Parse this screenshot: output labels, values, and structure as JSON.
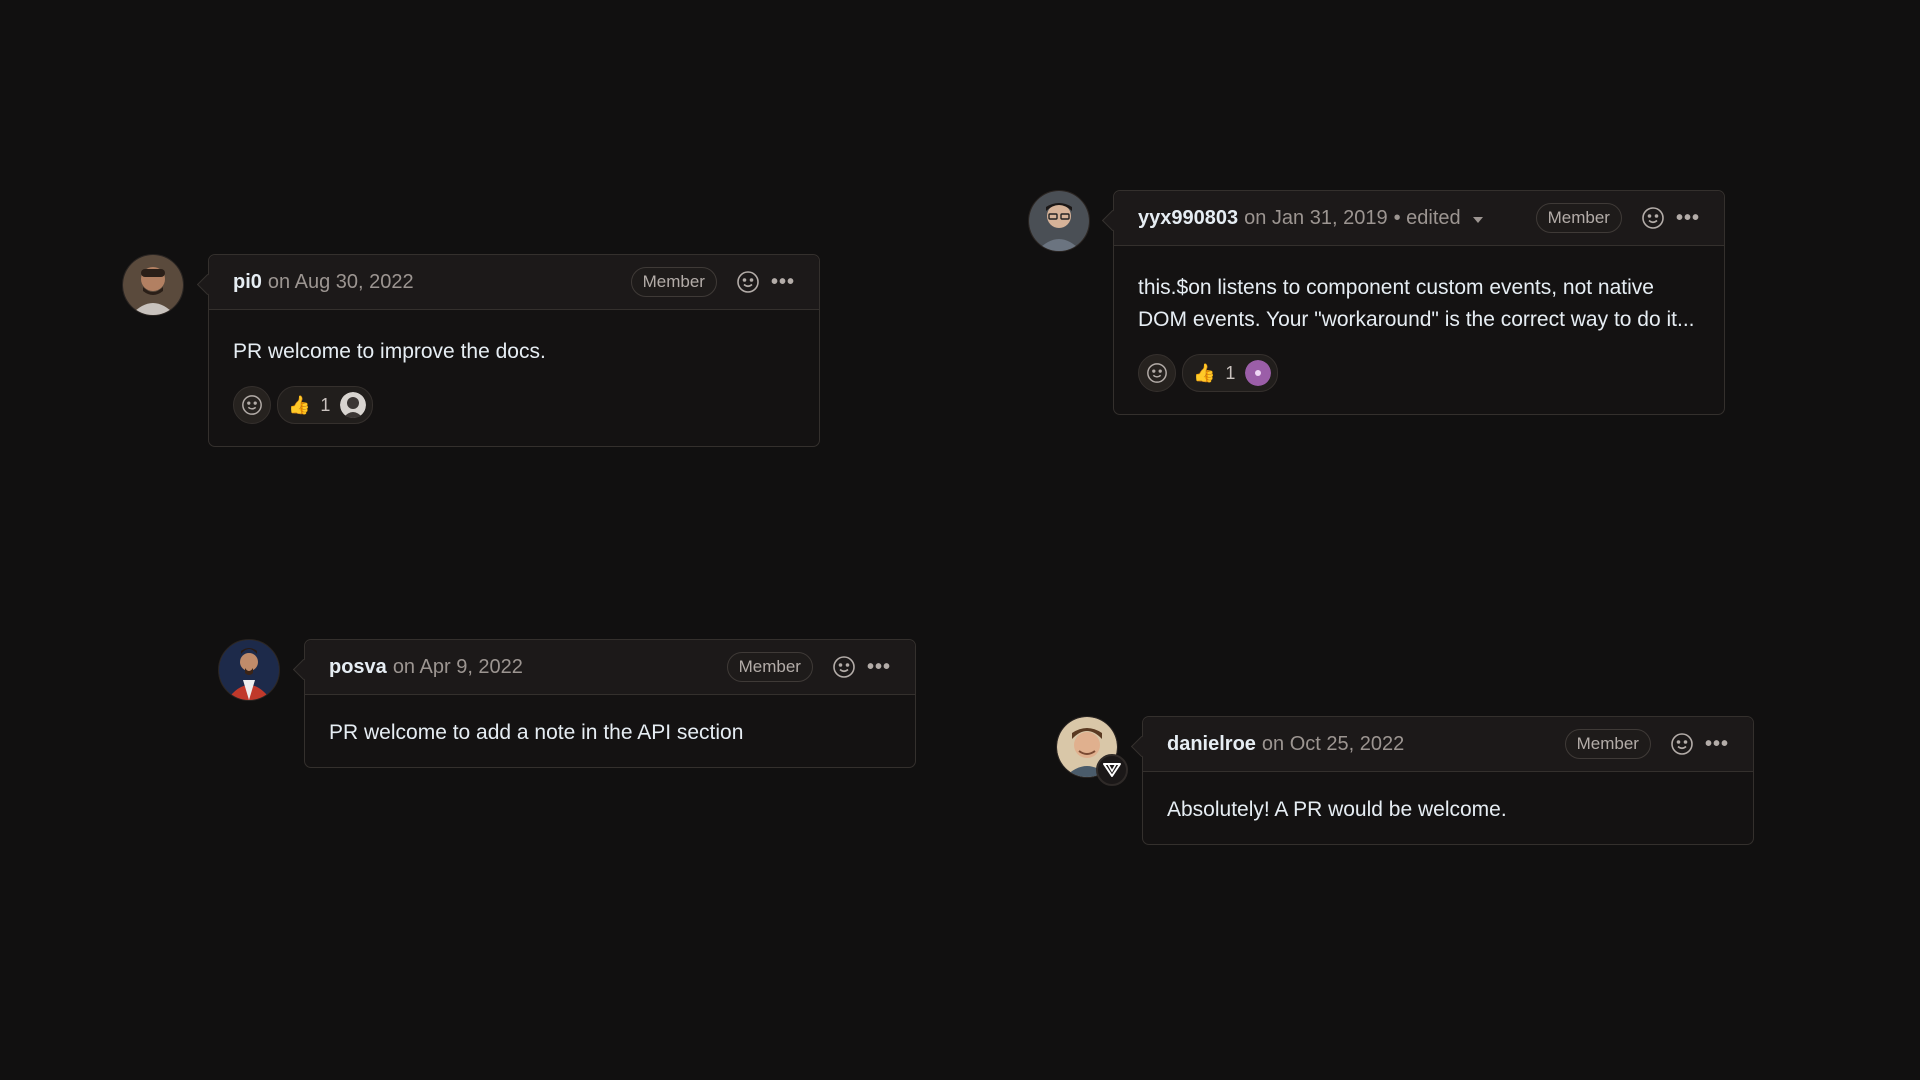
{
  "comments": [
    {
      "author": "pi0",
      "date": "on Aug 30, 2022",
      "role": "Member",
      "body": "PR welcome to improve the docs.",
      "reaction": {
        "emoji": "👍",
        "count": "1"
      }
    },
    {
      "author": "yyx990803",
      "date": "on Jan 31, 2019",
      "edited": "• edited",
      "role": "Member",
      "body_line1": "this.$on listens to component custom events, not native",
      "body_line2": "DOM events. Your \"workaround\" is the correct way to do it...",
      "reaction": {
        "emoji": "👍",
        "count": "1"
      }
    },
    {
      "author": "posva",
      "date": "on Apr 9, 2022",
      "role": "Member",
      "body": "PR welcome to add a note in the API section"
    },
    {
      "author": "danielroe",
      "date": "on Oct 25, 2022",
      "role": "Member",
      "body": "Absolutely! A PR would be welcome."
    }
  ],
  "icons": {
    "more": "•••",
    "smiley": "smiley-icon",
    "thumbs_up": "thumbs-up-icon"
  },
  "colors": {
    "background": "#111010",
    "card_border": "#34302d",
    "header_bg": "#1c1919",
    "muted_text": "#9c9591"
  }
}
